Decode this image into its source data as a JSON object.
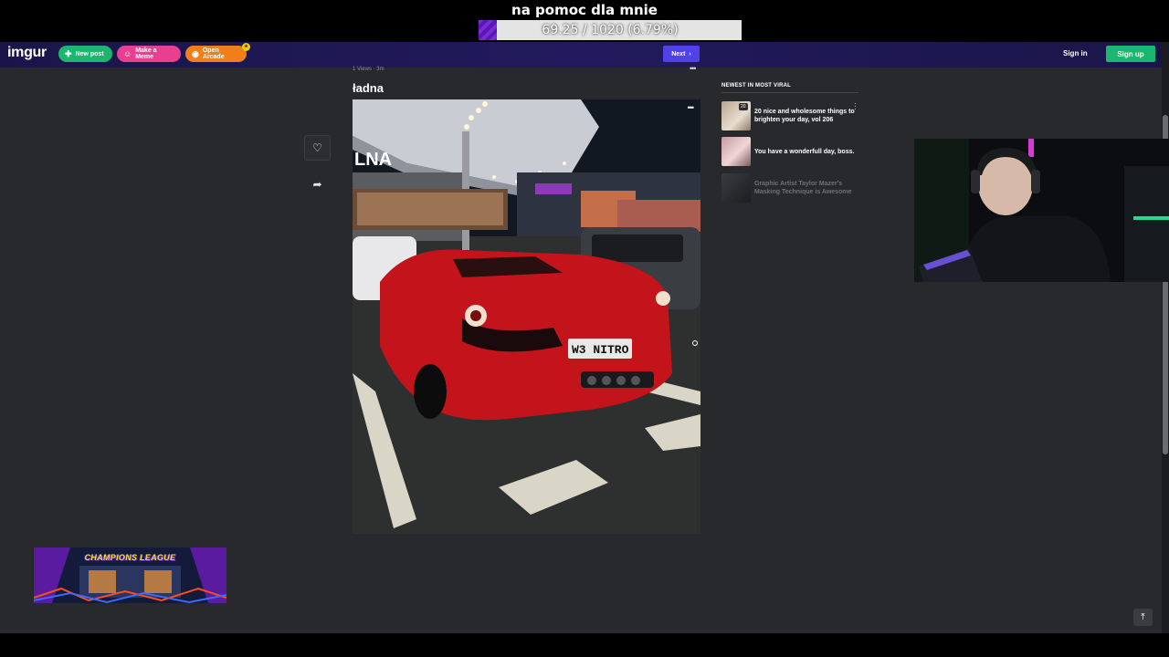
{
  "stream_goal": {
    "title": "na pomoc dla mnie",
    "progress_text": "69.25 / 1020 (6.79%)",
    "progress_fraction": 0.0679
  },
  "topnav": {
    "logo": "imgur",
    "new_post": "New post",
    "make_meme": "Make a Meme",
    "open_arcade": "Open Arcade",
    "next": "Next",
    "sign_in": "Sign in",
    "sign_up": "Sign up"
  },
  "post": {
    "meta": "1 Views · 3m",
    "title": "ładna",
    "image": {
      "subject": "red sports car",
      "plate": "W3 NITRO",
      "sign": "LNA",
      "colors": {
        "car": "#c4141b",
        "sky": "#121821",
        "ground": "#2e2f2f"
      }
    }
  },
  "sidebar": {
    "heading": "NEWEST IN MOST VIRAL",
    "items": [
      {
        "title": "20 nice and wholesome things to brighten your day, vol 206",
        "badge": "20"
      },
      {
        "title": "You have a wonderfull day, boss."
      },
      {
        "title": "Graphic Artist Taylor Mazer's Masking Technique is Awesome"
      }
    ]
  },
  "overlays": {
    "banner_text": "CHAMPIONS LEAGUE"
  },
  "colors": {
    "page_bg": "#27292d",
    "nav_bg": "#1e1852",
    "green": "#1bb76e",
    "pink": "#e83f91",
    "orange": "#f07f1b",
    "purple": "#5142e8"
  }
}
